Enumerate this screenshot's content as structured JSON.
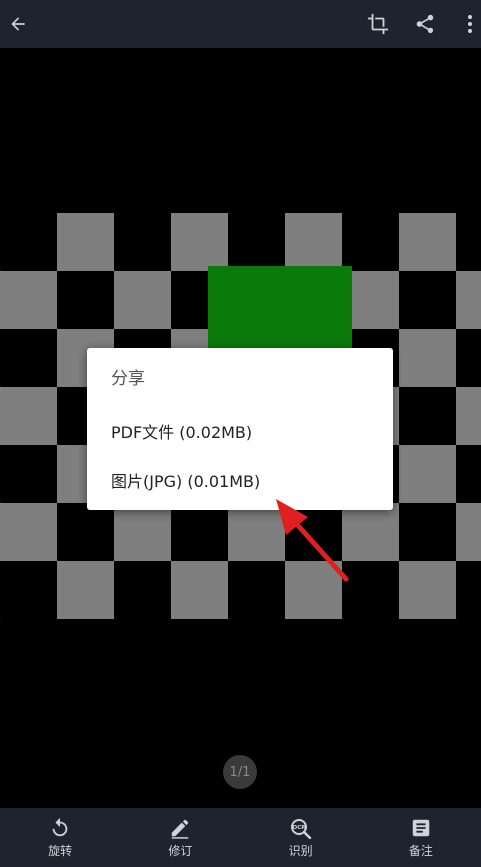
{
  "top_bar": {
    "icons": [
      "back-arrow-icon",
      "crop-icon",
      "share-icon",
      "more-vert-icon"
    ]
  },
  "document": {
    "page_indicator": "1/1",
    "colors": {
      "checker_light": "#7f7f7f",
      "checker_dark": "#000000",
      "green_block": "#0a7a0a"
    }
  },
  "share_dialog": {
    "title": "分享",
    "items": [
      {
        "label": "PDF文件 (0.02MB)"
      },
      {
        "label": "图片(JPG) (0.01MB)"
      }
    ]
  },
  "bottom_bar": {
    "tools": [
      {
        "label": "旋转",
        "icon": "rotate-icon"
      },
      {
        "label": "修订",
        "icon": "pencil-icon"
      },
      {
        "label": "识别",
        "icon": "ocr-icon"
      },
      {
        "label": "备注",
        "icon": "note-icon"
      }
    ]
  },
  "colors": {
    "bar_background": "#1d2430",
    "icon_color": "#cfd3d8",
    "annotation_arrow": "#e02020"
  }
}
